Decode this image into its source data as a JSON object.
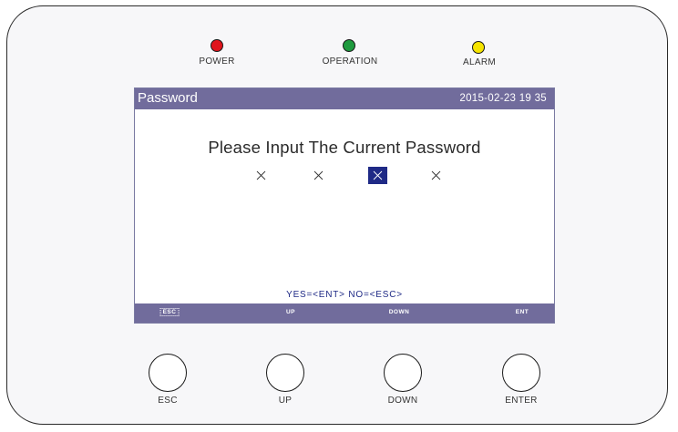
{
  "indicators": [
    {
      "label": "POWER",
      "color": "#e0141c"
    },
    {
      "label": "OPERATION",
      "color": "#1e9a3e"
    },
    {
      "label": "ALARM",
      "color": "#f5e400"
    }
  ],
  "screen": {
    "title": "Password",
    "datetime": "2015-02-23  19 35",
    "prompt": "Please Input The Current Password",
    "password_digits": [
      "×",
      "×",
      "×",
      "×"
    ],
    "selected_digit_index": 2,
    "confirm_text": "YES=<ENT>  NO=<ESC>",
    "footer_keys": [
      "ESC",
      "UP",
      "DOWN",
      "ENT"
    ]
  },
  "buttons": [
    {
      "label": "ESC"
    },
    {
      "label": "UP"
    },
    {
      "label": "DOWN"
    },
    {
      "label": "ENTER"
    }
  ],
  "colors": {
    "screen_bar": "#716c9c",
    "selection": "#1f2a86",
    "confirm_text": "#1f2a86"
  }
}
